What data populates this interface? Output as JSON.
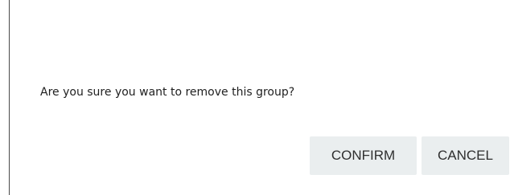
{
  "dialog": {
    "message": "Are you sure you want to remove this group?",
    "confirm_label": "CONFIRM",
    "cancel_label": "CANCEL"
  },
  "colors": {
    "button_background": "#eaeeef",
    "text": "#1f1f1f",
    "divider": "#4a4a4a"
  }
}
